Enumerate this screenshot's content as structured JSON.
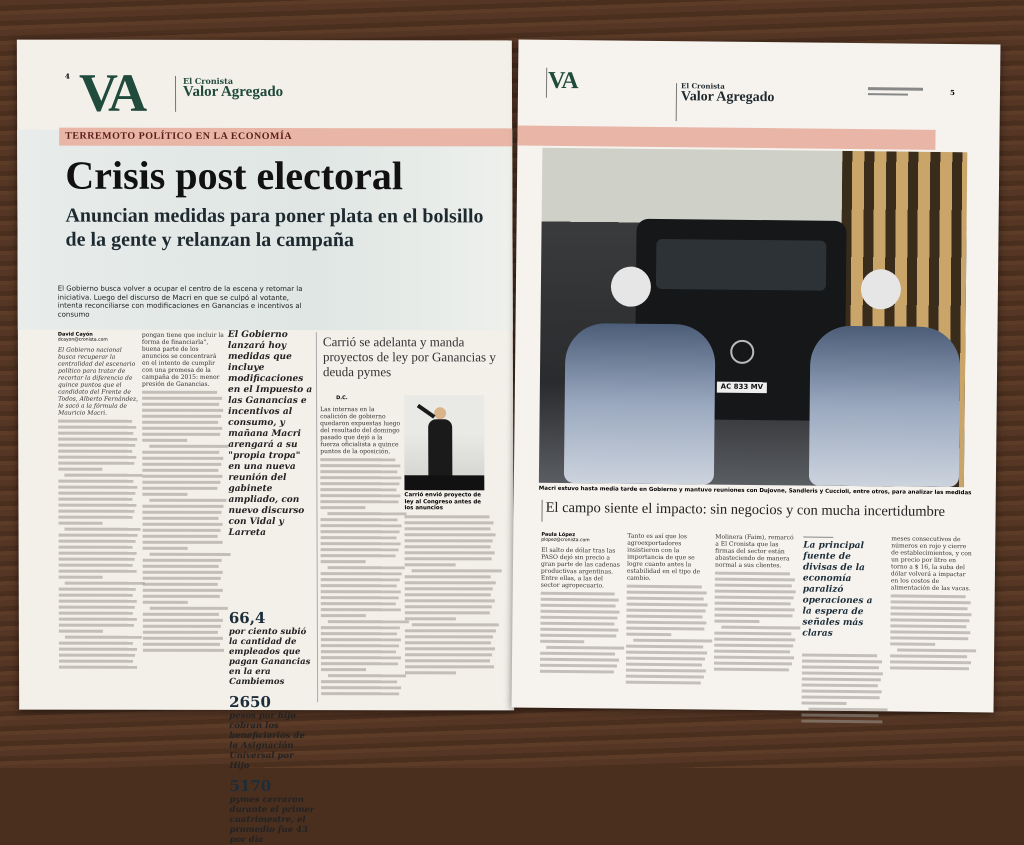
{
  "left_page": {
    "page_number": "4",
    "logo": "VA",
    "publisher": "El Cronista",
    "section": "Valor Agregado",
    "kicker": "TERREMOTO POLÍTICO EN LA ECONOMÍA",
    "headline": "Crisis post electoral",
    "subheadline": "Anuncian medidas para poner plata en el bolsillo de la gente y relanzan la campaña",
    "deck": "El Gobierno busca volver a ocupar el centro de la escena y retomar la iniciativa. Luego del discurso de Macri en que se culpó al votante, intenta reconciliarse con modificaciones en Ganancias e incentivos al consumo",
    "byline": "David Cayón",
    "byline_email": "dcayon@cronista.com",
    "lead": "El Gobierno nacional busca recuperar la centralidad del escenario político para tratar de recortar la diferencia de quince puntos que el candidato del Frente de Todos, Alberto Fernández, le sacó a la fórmula de Mauricio Macri.",
    "col2_text": "pongan tiene que incluir la forma de financiarla\", buena parte de los anuncios se concentrará en el intento de cumplir con una promesa de la campaña de 2015: menor presión de Ganancias.",
    "sidebar_quote": "El Gobierno lanzará hoy medidas que incluye modificaciones en el Impuesto a las Ganancias e incentivos al consumo, y mañana Macri arengará a su \"propia tropa\" en una nueva reunión del gabinete ampliado, con nuevo discurso con Vidal y Larreta",
    "stats": [
      {
        "value": "66,4",
        "label": "por ciento subió la cantidad de empleados que pagan Ganancias en la era Cambiemos"
      },
      {
        "value": "2650",
        "label": "pesos por hijo cobran los beneficiarios de la Asignación Universal por Hijo"
      },
      {
        "value": "5170",
        "label": "pymes cerraron durante el primer cuatrimestre, el promedio fue 43 por día"
      }
    ],
    "secondary_headline": "Carrió se adelanta y manda proyectos de ley por Ganancias y deuda pymes",
    "secondary_byline": "D.C.",
    "secondary_lead": "Las internas en la coalición de gobierno quedaron expuestas luego del resultado del domingo pasado que dejó a la fuerza oficialista a quince puntos de la oposición.",
    "photo_caption": "Carrió envió proyecto de ley al Congreso antes de los anuncios"
  },
  "right_page": {
    "page_number": "5",
    "logo": "VA",
    "publisher": "El Cronista",
    "section": "Valor Agregado",
    "photo_plate": "AC 833 MV",
    "photo_caption": "Macri estuvo hasta media tarde en Gobierno y mantuvo reuniones con Dujovne, Sandleris y Cuccioli, entre otros, para analizar las medidas",
    "headline": "El campo siente el impacto: sin negocios y con mucha incertidumbre",
    "byline": "Paula López",
    "byline_email": "plopez@cronista.com",
    "lead": "El salto de dólar tras las PASO dejó sin precio a gran parte de las cadenas productivas argentinas. Entre ellas, a las del sector agropecuario.",
    "col2_text": "Tanto es así que los agroexportadores insistieron con la importancia de que se logre cuanto antes la estabilidad en el tipo de cambio.",
    "col3_text": "Molinera (Faim), remarcó a El Cronista que las firmas del sector están abasteciendo de manera normal a sus clientes.",
    "pull_quote": "La principal fuente de divisas de la economía paralizó operaciones a la espera de señales más claras",
    "col5_text": "meses consecutivos de números en rojo y cierre de establecimientos, y con un precio por litro en torno a $ 16, la suba del dólar volverá a impactar en los costos de alimentación de las vacas."
  },
  "colors": {
    "brand": "#1f4a3c",
    "kicker_band": "#e9b5a6"
  }
}
